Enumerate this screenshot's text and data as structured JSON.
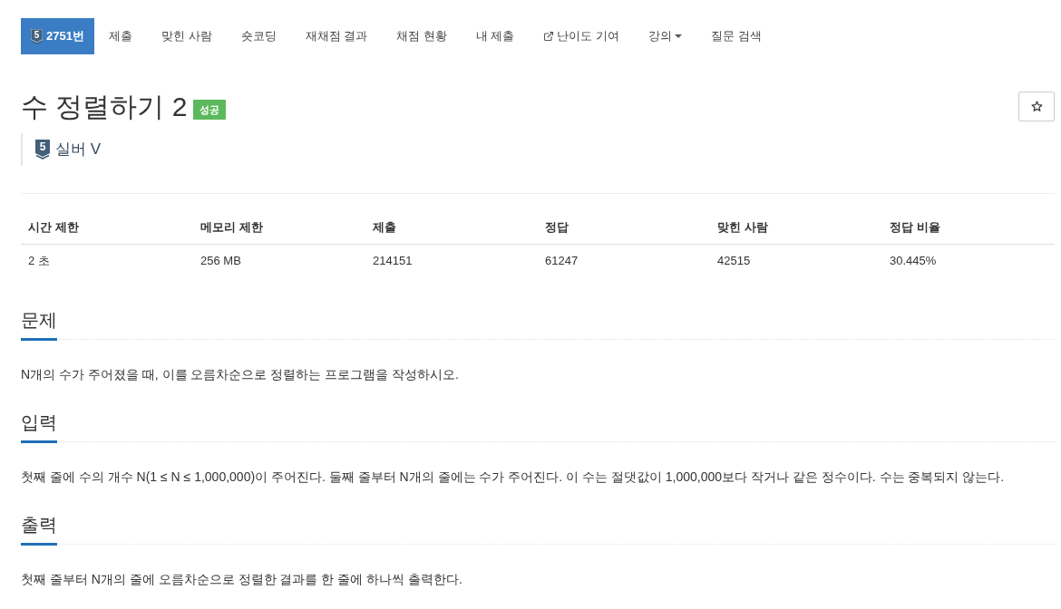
{
  "nav": {
    "items": [
      {
        "kind": "problem",
        "tier_number": "5",
        "label": "2751번",
        "selected": true
      },
      {
        "kind": "link",
        "label": "제출",
        "selected": false
      },
      {
        "kind": "link",
        "label": "맞힌 사람",
        "selected": false
      },
      {
        "kind": "link",
        "label": "숏코딩",
        "selected": false
      },
      {
        "kind": "link",
        "label": "재채점 결과",
        "selected": false
      },
      {
        "kind": "link",
        "label": "채점 현황",
        "selected": false
      },
      {
        "kind": "link",
        "label": "내 제출",
        "selected": false
      },
      {
        "kind": "external",
        "label": "난이도 기여",
        "selected": false
      },
      {
        "kind": "dropdown",
        "label": "강의",
        "selected": false
      },
      {
        "kind": "link",
        "label": "질문 검색",
        "selected": false
      }
    ]
  },
  "problem": {
    "title": "수 정렬하기 2",
    "result_badge": "성공",
    "starred": false
  },
  "tier": {
    "number": "5",
    "name": "실버 V"
  },
  "stats": {
    "columns": [
      "시간 제한",
      "메모리 제한",
      "제출",
      "정답",
      "맞힌 사람",
      "정답 비율"
    ],
    "rows": [
      [
        "2 초",
        "256 MB",
        "214151",
        "61247",
        "42515",
        "30.445%"
      ]
    ]
  },
  "sections": [
    {
      "heading": "문제",
      "text": "N개의 수가 주어졌을 때, 이를 오름차순으로 정렬하는 프로그램을 작성하시오."
    },
    {
      "heading": "입력",
      "text": "첫째 줄에 수의 개수 N(1 ≤ N ≤ 1,000,000)이 주어진다. 둘째 줄부터 N개의 줄에는 수가 주어진다. 이 수는 절댓값이 1,000,000보다 작거나 같은 정수이다. 수는 중복되지 않는다."
    },
    {
      "heading": "출력",
      "text": "첫째 줄부터 N개의 줄에 오름차순으로 정렬한 결과를 한 줄에 하나씩 출력한다."
    }
  ]
}
